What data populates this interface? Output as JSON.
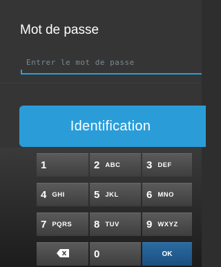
{
  "header": {
    "title": "Mot de passe"
  },
  "password": {
    "placeholder": "Entrer le mot de passe",
    "value": ""
  },
  "login_button": {
    "label": "Identification"
  },
  "keypad": {
    "keys": [
      {
        "num": "1",
        "letters": ""
      },
      {
        "num": "2",
        "letters": "ABC"
      },
      {
        "num": "3",
        "letters": "DEF"
      },
      {
        "num": "4",
        "letters": "GHI"
      },
      {
        "num": "5",
        "letters": "JKL"
      },
      {
        "num": "6",
        "letters": "MNO"
      },
      {
        "num": "7",
        "letters": "PQRS"
      },
      {
        "num": "8",
        "letters": "TUV"
      },
      {
        "num": "9",
        "letters": "WXYZ"
      },
      {
        "num": "0",
        "letters": ""
      }
    ],
    "ok_label": "OK",
    "delete_icon": "backspace-icon"
  },
  "colors": {
    "accent": "#2a9dd9",
    "ok_key": "#1c4f80",
    "background": "#353535"
  }
}
